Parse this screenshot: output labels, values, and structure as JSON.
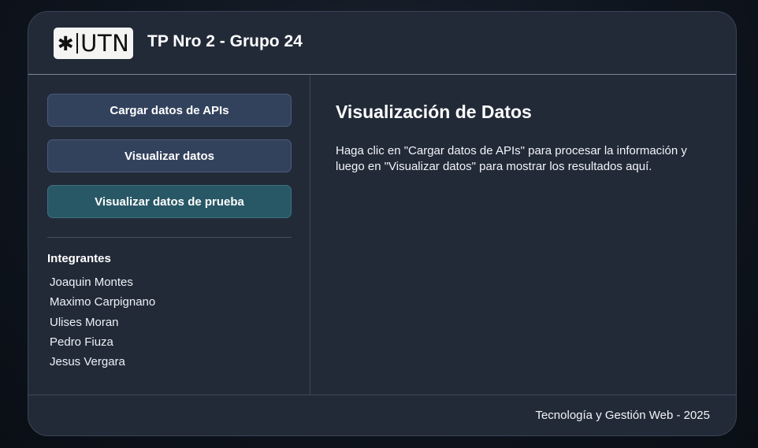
{
  "header": {
    "logo_text": "UTN",
    "title": "TP Nro 2 - Grupo 24"
  },
  "sidebar": {
    "buttons": [
      {
        "label": "Cargar datos de APIs"
      },
      {
        "label": "Visualizar datos"
      },
      {
        "label": "Visualizar datos de prueba"
      }
    ],
    "members_title": "Integrantes",
    "members": [
      "Joaquin Montes",
      "Maximo Carpignano",
      "Ulises Moran",
      "Pedro Fiuza",
      "Jesus Vergara"
    ]
  },
  "main": {
    "title": "Visualización de Datos",
    "text": "Haga clic en \"Cargar datos de APIs\" para procesar la información y luego en \"Visualizar datos\" para mostrar los resultados aquí."
  },
  "footer": {
    "text": "Tecnología y Gestión Web - 2025"
  },
  "colors": {
    "panel": "#222a38",
    "button": "#33425c",
    "button_alt": "#285765"
  }
}
